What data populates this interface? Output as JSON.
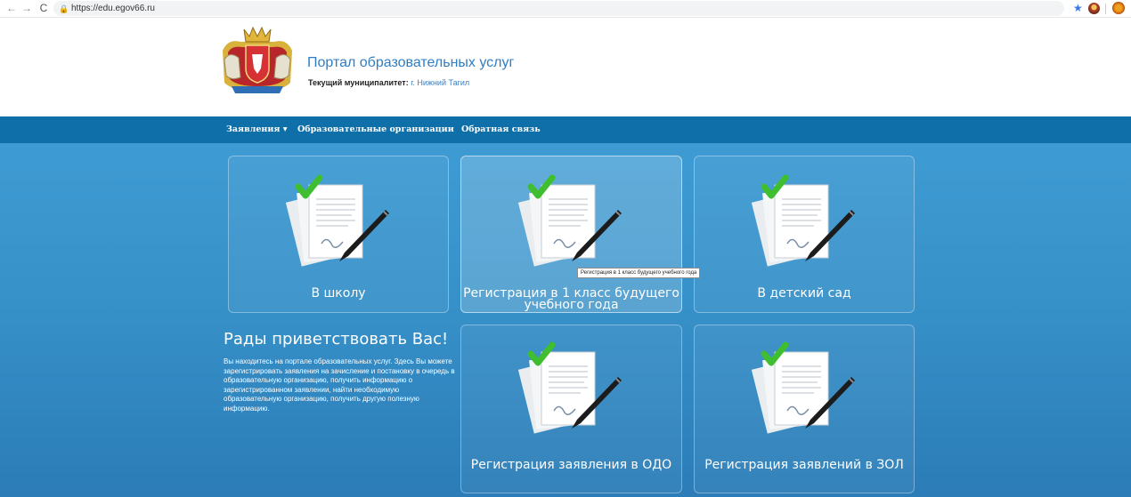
{
  "browser": {
    "url": "https://edu.egov66.ru",
    "icons": [
      "back-icon",
      "forward-icon",
      "reload-icon",
      "lock-icon",
      "bookmark-star-icon",
      "extension-icon",
      "extension-icon"
    ]
  },
  "header": {
    "title": "Портал образовательных услуг",
    "municipality_label": "Текущий муниципалитет:",
    "municipality_value": "г. Нижний Тагил"
  },
  "nav": {
    "items": [
      {
        "label": "Заявления ▾"
      },
      {
        "label": "Образовательные организации"
      },
      {
        "label": "Обратная связь"
      }
    ]
  },
  "tiles": [
    {
      "label": "В школу"
    },
    {
      "label": "Регистрация в 1 класс будущего учебного года"
    },
    {
      "label": "В детский сад"
    },
    {
      "label": "Регистрация заявления в ОДО"
    },
    {
      "label": "Регистрация заявлений в ЗОЛ"
    }
  ],
  "tooltip": "Регистрация в 1 класс будущего учебного года",
  "welcome": {
    "title": "Рады приветствовать Вас!",
    "text": "Вы находитесь на портале образовательных услуг. Здесь Вы можете зарегистрировать заявления на зачисление и постановку в очередь в образовательную организацию, получить информацию о зарегистрированном заявлении, найти необходимую образовательную организацию, получить другую полезную информацию."
  },
  "colors": {
    "nav_bar": "#0f6fa8",
    "main_bg": "#3791c9",
    "title_link": "#2f7dc2"
  }
}
